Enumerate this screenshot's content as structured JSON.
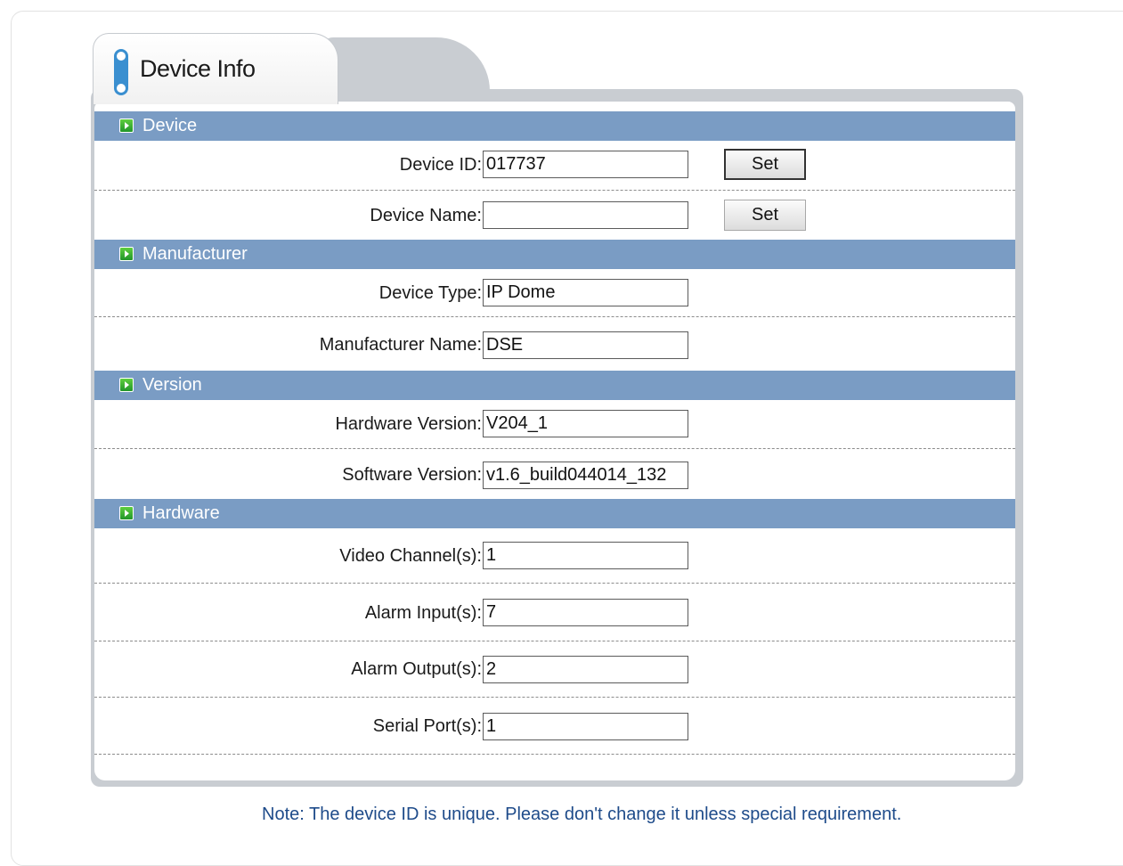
{
  "tab": {
    "title": "Device Info",
    "icon": "info-pill-icon"
  },
  "sections": {
    "device": {
      "header": "Device",
      "device_id": {
        "label": "Device ID:",
        "value": "017737",
        "button": "Set"
      },
      "device_name": {
        "label": "Device Name:",
        "value": "",
        "button": "Set"
      }
    },
    "manufacturer": {
      "header": "Manufacturer",
      "device_type": {
        "label": "Device Type:",
        "value": "IP Dome"
      },
      "manufacturer_name": {
        "label": "Manufacturer Name:",
        "value": "DSE"
      }
    },
    "version": {
      "header": "Version",
      "hardware_version": {
        "label": "Hardware Version:",
        "value": "V204_1"
      },
      "software_version": {
        "label": "Software Version:",
        "value": "v1.6_build044014_132"
      }
    },
    "hardware": {
      "header": "Hardware",
      "video_channels": {
        "label": "Video Channel(s):",
        "value": "1"
      },
      "alarm_inputs": {
        "label": "Alarm Input(s):",
        "value": "7"
      },
      "alarm_outputs": {
        "label": "Alarm Output(s):",
        "value": "2"
      },
      "serial_ports": {
        "label": "Serial Port(s):",
        "value": "1"
      }
    }
  },
  "note": "Note: The device ID is unique. Please don't change it unless special requirement.",
  "colors": {
    "section_header_bg": "#7a9cc4",
    "panel_frame": "#c9cdd2",
    "note_text": "#1e4b8a",
    "section_arrow": "#21952a"
  }
}
